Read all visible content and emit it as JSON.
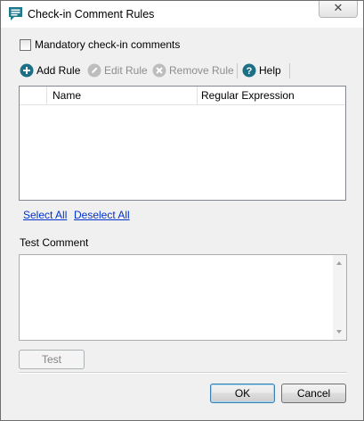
{
  "window": {
    "title": "Check-in Comment Rules",
    "close_glyph": "✕"
  },
  "options": {
    "mandatory_label": "Mandatory check-in comments",
    "mandatory_checked": false
  },
  "toolbar": {
    "add_rule": "Add Rule",
    "edit_rule": "Edit Rule",
    "remove_rule": "Remove Rule",
    "help": "Help",
    "icons": {
      "add": "plus-circle-icon",
      "edit": "pencil-icon",
      "remove": "x-circle-icon",
      "help": "question-mark-icon"
    }
  },
  "rules_table": {
    "columns": [
      "",
      "Name",
      "Regular Expression"
    ],
    "rows": []
  },
  "links": {
    "select_all": "Select All",
    "deselect_all": "Deselect All"
  },
  "test": {
    "label": "Test Comment",
    "value": "",
    "button": "Test"
  },
  "footer": {
    "ok": "OK",
    "cancel": "Cancel"
  },
  "colors": {
    "accent_teal": "#1d7a8c",
    "link": "#0033cc",
    "disabled_text": "#8d8d8d"
  }
}
